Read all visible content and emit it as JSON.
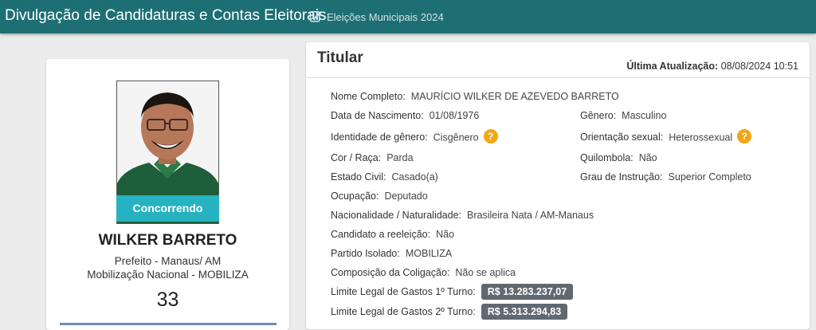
{
  "header": {
    "app_title": "Divulgação de Candidaturas e Contas Eleitorais",
    "subtitle": "Eleições Municipais 2024"
  },
  "candidate": {
    "status": "Concorrendo",
    "name": "WILKER BARRETO",
    "role": "Prefeito - Manaus/ AM",
    "party": "Mobilização Nacional - MOBILIZA",
    "number": "33"
  },
  "details": {
    "title": "Titular",
    "last_update_label": "Última Atualização:",
    "last_update_value": "08/08/2024 10:51",
    "fields": {
      "nome": {
        "label": "Nome Completo:",
        "value": "MAURÍCIO WILKER DE AZEVEDO BARRETO"
      },
      "nascimento": {
        "label": "Data de Nascimento:",
        "value": "01/08/1976"
      },
      "genero": {
        "label": "Gênero:",
        "value": "Masculino"
      },
      "identidade": {
        "label": "Identidade de gênero:",
        "value": "Cisgênero"
      },
      "orientacao": {
        "label": "Orientação sexual:",
        "value": "Heterossexual"
      },
      "cor": {
        "label": "Cor / Raça:",
        "value": "Parda"
      },
      "quilombola": {
        "label": "Quilombola:",
        "value": "Não"
      },
      "estado_civil": {
        "label": "Estado Civil:",
        "value": "Casado(a)"
      },
      "instrucao": {
        "label": "Grau de Instrução:",
        "value": "Superior Completo"
      },
      "ocupacao": {
        "label": "Ocupação:",
        "value": "Deputado"
      },
      "nacionalidade": {
        "label": "Nacionalidade / Naturalidade:",
        "value": "Brasileira Nata / AM-Manaus"
      },
      "reeleicao": {
        "label": "Candidato a reeleição:",
        "value": "Não"
      },
      "partido": {
        "label": "Partido Isolado:",
        "value": "MOBILIZA"
      },
      "coligacao": {
        "label": "Composição da Coligação:",
        "value": "Não se aplica"
      },
      "limite1": {
        "label": "Limite Legal de Gastos 1º Turno:",
        "value": "R$ 13.283.237,07"
      },
      "limite2": {
        "label": "Limite Legal de Gastos 2º Turno:",
        "value": "R$ 5.313.294,83"
      }
    }
  },
  "icons": {
    "edit": "edit-icon",
    "help": "question-icon"
  },
  "colors": {
    "header": "#1e6f73",
    "status_badge": "#26b2c1",
    "help_icon": "#f5a516",
    "money_badge": "#606870"
  }
}
